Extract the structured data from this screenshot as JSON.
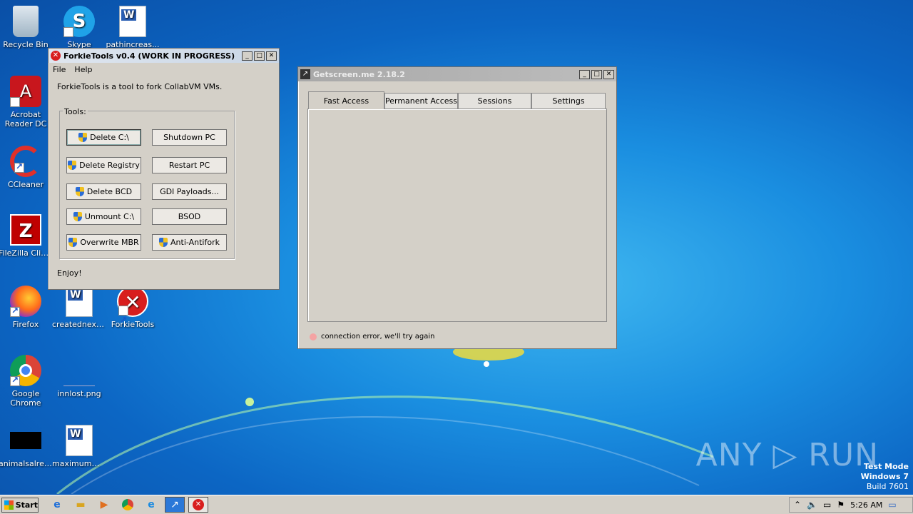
{
  "desktop": {
    "icons": [
      {
        "label": "Recycle Bin"
      },
      {
        "label": "Skype"
      },
      {
        "label": "pathincreas..."
      },
      {
        "label": "Acrobat Reader DC"
      },
      {
        "label": "CCleaner"
      },
      {
        "label": "FileZilla Client"
      },
      {
        "label": "Firefox"
      },
      {
        "label": "creatednext..."
      },
      {
        "label": "ForkieTools"
      },
      {
        "label": "Google Chrome"
      },
      {
        "label": "innlost.png"
      },
      {
        "label": "animalsalrea..."
      },
      {
        "label": "maximummm..."
      }
    ]
  },
  "forkie": {
    "title": "ForkieTools v0.4 (WORK IN PROGRESS)",
    "menu": [
      "File",
      "Help"
    ],
    "description": "ForkieTools is a tool to fork CollabVM VMs.",
    "group_label": "Tools:",
    "buttons": {
      "delete_c": "Delete C:\\",
      "shutdown": "Shutdown PC",
      "delete_registry": "Delete Registry",
      "restart": "Restart PC",
      "delete_bcd": "Delete BCD",
      "gdi": "GDI Payloads...",
      "unmount": "Unmount C:\\",
      "bsod": "BSOD",
      "overwrite_mbr": "Overwrite MBR",
      "anti_antifork": "Anti-Antifork"
    },
    "footer": "Enjoy!"
  },
  "getscreen": {
    "title": "Getscreen.me 2.18.2",
    "tabs": [
      "Fast Access",
      "Permanent Access",
      "Sessions",
      "Settings"
    ],
    "status": "connection error, we'll try again"
  },
  "watermark": "ANY ▷ RUN",
  "testmode": {
    "line1": "Test Mode",
    "line2": "Windows 7",
    "line3": "Build 7601"
  },
  "taskbar": {
    "start_label": "Start",
    "clock": "5:26 AM"
  },
  "colors": {
    "status_dot": "#f4a3a3",
    "window_bg": "#d4d0c8"
  }
}
